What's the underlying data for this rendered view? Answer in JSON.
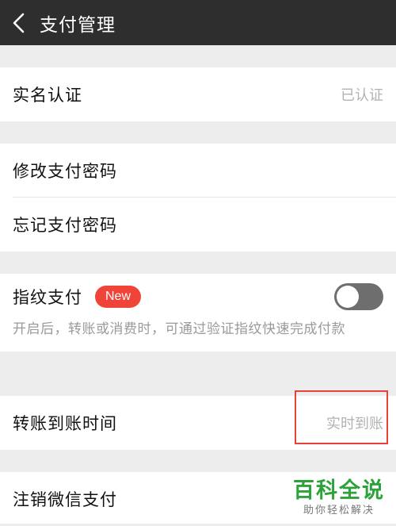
{
  "header": {
    "title": "支付管理",
    "back_icon": "chevron-left-icon"
  },
  "sections": {
    "real_name": {
      "label": "实名认证",
      "value": "已认证"
    },
    "password": {
      "change_label": "修改支付密码",
      "forgot_label": "忘记支付密码"
    },
    "fingerprint": {
      "label": "指纹支付",
      "badge": "New",
      "toggle_on": false,
      "hint": "开启后，转账或消费时，可通过验证指纹快速完成付款"
    },
    "transfer_time": {
      "label": "转账到账时间",
      "value": "实时到账"
    },
    "cancel": {
      "label": "注销微信支付"
    }
  },
  "watermark": {
    "main": "百科全说",
    "sub": "助你轻松解决"
  },
  "colors": {
    "header_bg": "#2e2e2e",
    "page_bg": "#ededed",
    "badge_red": "#f04438",
    "highlight_red": "#e8413a",
    "watermark_green": "#2ca33a"
  }
}
